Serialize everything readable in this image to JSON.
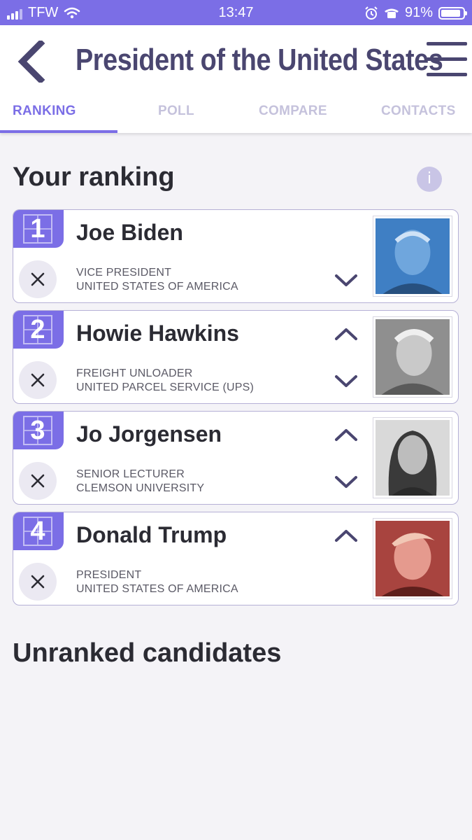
{
  "status_bar": {
    "carrier": "TFW",
    "time": "13:47",
    "battery": "91%",
    "battery_level": 0.91
  },
  "header": {
    "title": "President of the United States",
    "tabs": [
      {
        "label": "RANKING",
        "active": true
      },
      {
        "label": "POLL",
        "active": false
      },
      {
        "label": "COMPARE",
        "active": false
      },
      {
        "label": "CONTACTS",
        "active": false
      }
    ]
  },
  "ranking": {
    "heading": "Your ranking",
    "info_label": "i",
    "candidates": [
      {
        "rank": "1",
        "name": "Joe Biden",
        "role_line1": "VICE PRESIDENT",
        "role_line2": "UNITED STATES OF AMERICA",
        "photo_tint": "#4a8ad0"
      },
      {
        "rank": "2",
        "name": "Howie Hawkins",
        "role_line1": "FREIGHT UNLOADER",
        "role_line2": "UNITED PARCEL SERVICE (UPS)",
        "photo_tint": "#9a9a9a"
      },
      {
        "rank": "3",
        "name": "Jo Jorgensen",
        "role_line1": "SENIOR LECTURER",
        "role_line2": "CLEMSON UNIVERSITY",
        "photo_tint": "#8a8a8a"
      },
      {
        "rank": "4",
        "name": "Donald Trump",
        "role_line1": "PRESIDENT",
        "role_line2": "UNITED STATES OF AMERICA",
        "photo_tint": "#b85a55"
      }
    ]
  },
  "unranked": {
    "heading": "Unranked candidates"
  },
  "colors": {
    "accent": "#7b6ee6",
    "title": "#4a4670",
    "tab_inactive": "#c5c2dc"
  }
}
